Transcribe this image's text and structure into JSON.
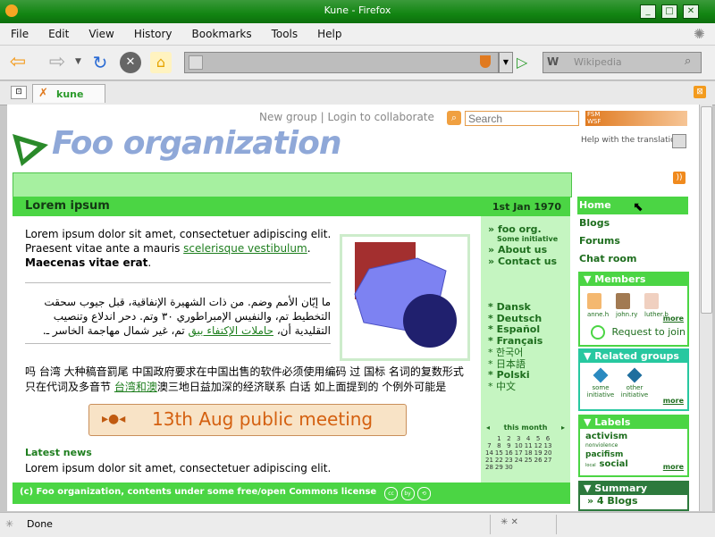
{
  "window": {
    "title": "Kune - Firefox"
  },
  "menu": [
    "File",
    "Edit",
    "View",
    "History",
    "Bookmarks",
    "Tools",
    "Help"
  ],
  "nav": {
    "search_placeholder": "Wikipedia",
    "url": ""
  },
  "tab": {
    "label": "kune"
  },
  "header": {
    "new_group": "New group",
    "separator": "|",
    "login": "Login to collaborate",
    "search_placeholder": "Search",
    "fsm_line1": "FSM",
    "fsm_line2": "WSF",
    "help_translation": "Help with the translation"
  },
  "group": {
    "name": "Foo organization"
  },
  "content": {
    "title": "Lorem ipsum",
    "date": "1st Jan 1970",
    "para1_a": "Lorem ipsum dolor sit amet, consectetuer adipiscing elit. Praesent vitae ante a mauris",
    "para1_link": "scelerisque vestibulum",
    "para1_b": ".",
    "para1_bold": "Maecenas vitae erat",
    "para1_end": ".",
    "arabic_a": "ما إيّان الأمم وضم. من ذات الشهيرة الإنفاقية، قبل جيوب سحقت التخطيط تم، والنفيس الإمبراطوري ٣٠ وتم. دحر اندلاع وتنصيب التقليدية أن،",
    "arabic_link": "حاملات الإكتفاء بيق",
    "arabic_b": "تم، غير شمال مهاجمة الخاسر ـ.",
    "cjk_a": "吗 台湾 大种稿音罰尾 中国政府要求在中国出售的软件必须使用编码 过 国标 名词的复数形式只在代词及多音节",
    "cjk_link": "台湾和澳",
    "cjk_b": "澳三地日益加深的经济联系 白话 如上面提到的 个例外可能是",
    "meeting": "13th Aug public meeting",
    "latest_news": "Latest news",
    "latest_text": "Lorem ipsum dolor sit amet, consectetuer adipiscing elit.",
    "footer": "(c) Foo organization, contents under some free/open Commons license"
  },
  "inner_side": {
    "links": [
      {
        "label": "foo org.",
        "sub": "Some initiative"
      },
      {
        "label": "About us"
      },
      {
        "label": "Contact us"
      }
    ],
    "langs": [
      "Dansk",
      "Deutsch",
      "Español",
      "Français",
      "한국어",
      "日本語",
      "Polski",
      "中文"
    ],
    "calendar_title": "this month",
    "calendar_weeks": [
      [
        "",
        "",
        "1",
        "2",
        "3",
        "4",
        "5",
        "6"
      ],
      [
        "",
        "7",
        "8",
        "9",
        "10",
        "11",
        "12",
        "13"
      ],
      [
        "",
        "14",
        "15",
        "16",
        "17",
        "18",
        "19",
        "20"
      ],
      [
        "",
        "21",
        "22",
        "23",
        "24",
        "25",
        "26",
        "27"
      ],
      [
        "",
        "28",
        "29",
        "30",
        "",
        "",
        "",
        ""
      ]
    ]
  },
  "sidebar": {
    "menu": [
      "Home",
      "Blogs",
      "Forums",
      "Chat room"
    ],
    "members_title": "Members",
    "members": [
      "anne.h",
      "john.ry",
      "luther.b"
    ],
    "members_more": "more",
    "request_join": "Request to join",
    "related_title": "Related groups",
    "related": [
      "some initiative",
      "other initiative"
    ],
    "related_more": "more",
    "labels_title": "Labels",
    "labels": [
      {
        "text": "activism",
        "size": "big"
      },
      {
        "text": "nonviolence",
        "size": "small"
      },
      {
        "text": "pacifism",
        "size": "mid"
      },
      {
        "text": "local",
        "size": "small"
      },
      {
        "text": "social",
        "size": "big"
      }
    ],
    "labels_more": "more",
    "summary_title": "Summary",
    "summary_item": "» 4 Blogs"
  },
  "status": {
    "text": "Done"
  },
  "colors": {
    "accent_green": "#4bd544",
    "light_green": "#a6f0a0",
    "teal": "#28c8a0",
    "orange": "#e07a20"
  }
}
